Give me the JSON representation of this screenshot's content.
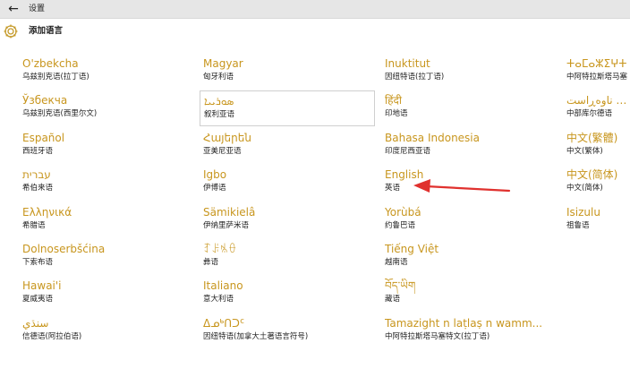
{
  "titlebar": {
    "title": "设置",
    "back_icon": "back-arrow-icon"
  },
  "header": {
    "title": "添加语言",
    "icon": "gear-icon"
  },
  "columns": [
    [
      {
        "name": "O'zbekcha",
        "sub": "乌兹别克语(拉丁语)"
      },
      {
        "name": "Ўзбекча",
        "sub": "乌兹别克语(西里尔文)"
      },
      {
        "name": "Español",
        "sub": "西班牙语"
      },
      {
        "name": "עברית",
        "sub": "希伯来语"
      },
      {
        "name": "Ελληνικά",
        "sub": "希腊语"
      },
      {
        "name": "Dolnoserbšćina",
        "sub": "下索布语"
      },
      {
        "name": "Hawai'i",
        "sub": "夏威夷语"
      },
      {
        "name": "سنڌي",
        "sub": "信德语(阿拉伯语)"
      }
    ],
    [
      {
        "name": "Magyar",
        "sub": "匈牙利语"
      },
      {
        "name": "ܣܘܪܝܝܐ",
        "sub": "叙利亚语"
      },
      {
        "name": "Հայերեն",
        "sub": "亚美尼亚语"
      },
      {
        "name": "Igbo",
        "sub": "伊博语"
      },
      {
        "name": "Sämikielâ",
        "sub": "伊纳里萨米语"
      },
      {
        "name": "ꆈꌠꁱꂷ",
        "sub": "彝语"
      },
      {
        "name": "Italiano",
        "sub": "意大利语"
      },
      {
        "name": "ᐃᓄᒃᑎᑐᑦ",
        "sub": "因纽特语(加拿大土著语言符号)"
      }
    ],
    [
      {
        "name": "Inuktitut",
        "sub": "因纽特语(拉丁语)"
      },
      {
        "name": "हिंदी",
        "sub": "印地语"
      },
      {
        "name": "Bahasa Indonesia",
        "sub": "印度尼西亚语"
      },
      {
        "name": "English",
        "sub": "英语"
      },
      {
        "name": "Yorùbá",
        "sub": "约鲁巴语"
      },
      {
        "name": "Tiếng Việt",
        "sub": "越南语"
      },
      {
        "name": "བོད་ཡིག",
        "sub": "藏语"
      },
      {
        "name": "Tamazight n laṭlaṣ n wamm...",
        "sub": "中阿特拉斯塔马塞特文(拉丁语)"
      }
    ],
    [
      {
        "name": "ⵜⴰⵎⴰⵣⵉⵖⵜ",
        "sub": "中阿特拉斯塔马塞"
      },
      {
        "name": "کوردیی ناوەڕاست",
        "sub": "中部库尔德语"
      },
      {
        "name": "中文(繁體)",
        "sub": "中文(繁体)"
      },
      {
        "name": "中文(简体)",
        "sub": "中文(简体)"
      },
      {
        "name": "Isizulu",
        "sub": "祖鲁语"
      }
    ]
  ],
  "colors": {
    "accent": "#c8961e",
    "arrow": "#e0312e"
  }
}
